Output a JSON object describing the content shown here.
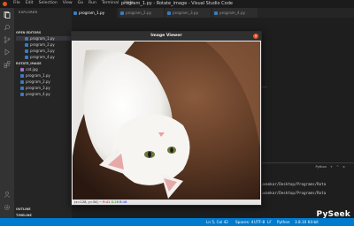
{
  "window": {
    "title": "program_1.py - Rotate_image - Visual Studio Code"
  },
  "menu": [
    "File",
    "Edit",
    "Selection",
    "View",
    "Go",
    "Run",
    "Terminal",
    "Help"
  ],
  "sidebar": {
    "header": "EXPLORER",
    "open_editors_label": "OPEN EDITORS",
    "open_editors": [
      "program_1.py",
      "program_2.py",
      "program_3.py",
      "program_4.py"
    ],
    "folder_label": "ROTATE_IMAGE",
    "files": [
      "cat.jpg",
      "program_1.py",
      "program_2.py",
      "program_3.py",
      "program_4.py"
    ],
    "outline_label": "OUTLINE",
    "timeline_label": "TIMELINE"
  },
  "tabs": [
    "program_1.py",
    "program_2.py",
    "program_3.py",
    "program_4.py"
  ],
  "panel": {
    "python_label": "Python",
    "terminal_lines": [
      "ru/suvankar/Desktop/Programs/Rota",
      "ru/suvankar/Desktop/Programs/Rota"
    ]
  },
  "statusbar": {
    "position": "Ln 5, Col 42",
    "spaces": "Spaces: 4",
    "encoding": "UTF-8",
    "eol": "LF",
    "language": "Python",
    "interpreter": "3.8.10 64-bit"
  },
  "viewer": {
    "title": "Image Viewer",
    "close": "×",
    "coords": "(x=128, y=34) ~",
    "r": "R:41",
    "g": "G:28",
    "b": "B:16"
  },
  "watermark": "PySeek",
  "colors": {
    "accent": "#007acc",
    "close": "#e95420"
  }
}
